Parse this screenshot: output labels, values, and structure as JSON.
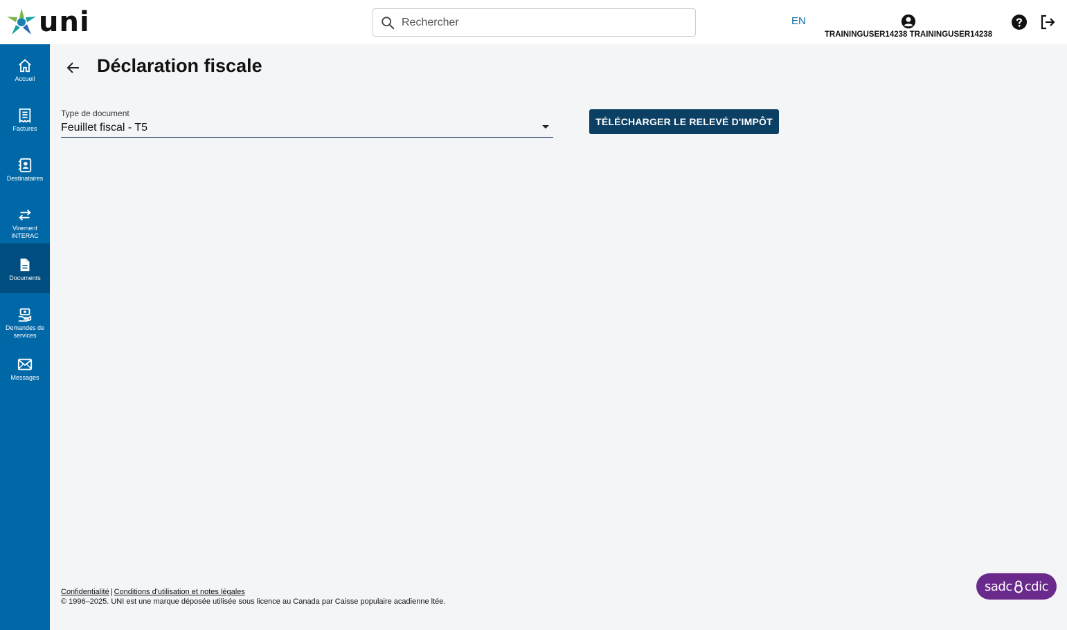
{
  "header": {
    "logo_text": "uni",
    "search_placeholder": "Rechercher",
    "language": "EN",
    "user_name": "TRAININGUSER14238 TRAININGUSER14238"
  },
  "sidebar": {
    "items": [
      {
        "label": "Accueil",
        "icon": "home-icon"
      },
      {
        "label": "Factures",
        "icon": "receipt-icon"
      },
      {
        "label": "Destinataires",
        "icon": "contacts-icon"
      },
      {
        "label": "Virement\nINTERAC",
        "icon": "transfer-icon"
      },
      {
        "label": "Documents",
        "icon": "document-icon",
        "active": true
      },
      {
        "label": "Demandes de\nservices",
        "icon": "service-request-icon"
      },
      {
        "label": "Messages",
        "icon": "mail-icon"
      }
    ]
  },
  "main": {
    "title": "Déclaration fiscale",
    "document_type_label": "Type de document",
    "document_type_value": "Feuillet fiscal - T5",
    "download_label": "TÉLÉCHARGER LE RELEVÉ D'IMPÔT"
  },
  "footer": {
    "privacy_link": "Confidentialité",
    "separator": "|",
    "terms_link": "Conditions d'utilisation et notes légales",
    "copyright": "© 1996–2025. UNI est une marque déposée utilisée sous licence au Canada par Caisse populaire acadienne ltée.",
    "cdic_left": "sadc",
    "cdic_right": "cdic"
  },
  "colors": {
    "sidebar": "#0168a8",
    "sidebar_active": "#004e7f",
    "button": "#0b3f63",
    "cdic": "#6a2a8c",
    "link": "#0a6ba8"
  }
}
